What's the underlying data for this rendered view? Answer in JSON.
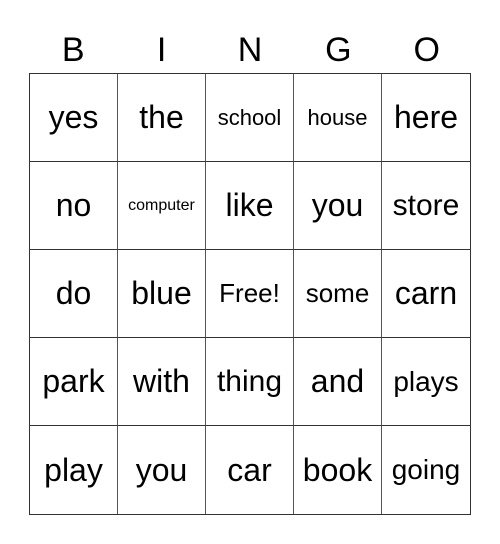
{
  "header": {
    "letters": [
      "B",
      "I",
      "N",
      "G",
      "O"
    ]
  },
  "board": {
    "rows": [
      [
        "yes",
        "the",
        "school",
        "house",
        "here"
      ],
      [
        "no",
        "computer",
        "like",
        "you",
        "store"
      ],
      [
        "do",
        "blue",
        "Free!",
        "some",
        "carn"
      ],
      [
        "park",
        "with",
        "thing",
        "and",
        "plays"
      ],
      [
        "play",
        "you",
        "car",
        "book",
        "going"
      ]
    ]
  }
}
